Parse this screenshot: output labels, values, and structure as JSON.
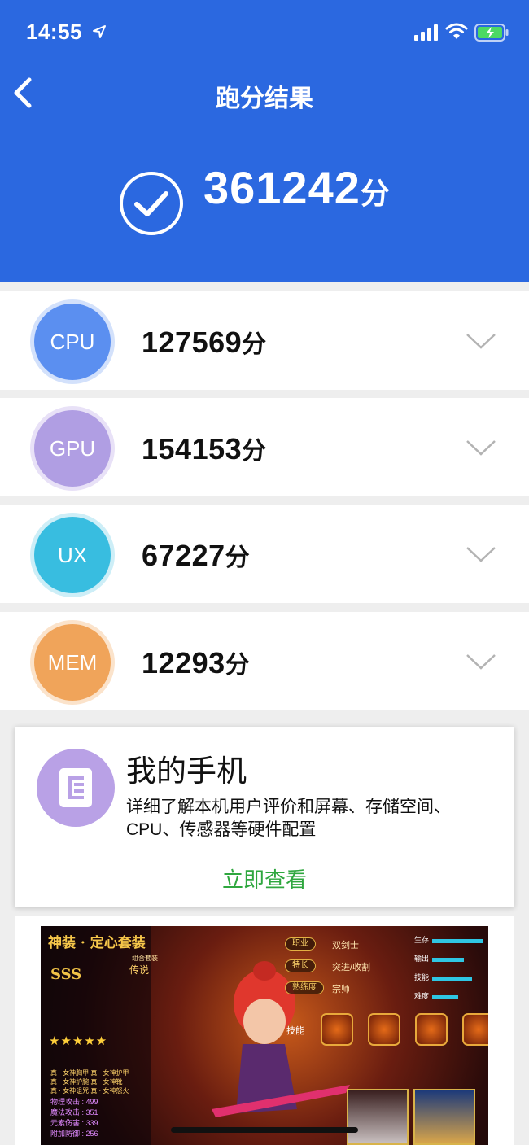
{
  "status_bar": {
    "time": "14:55",
    "icons": [
      "location-arrow-icon",
      "signal-icon",
      "wifi-icon",
      "battery-charging-icon"
    ]
  },
  "header": {
    "title": "跑分结果",
    "total_score": "361242",
    "score_unit": "分",
    "background": "#2b68e0"
  },
  "scores": [
    {
      "badge": "CPU",
      "score": "127569",
      "unit": "分",
      "color": "#5b8ff0",
      "ring": "#d3e1fb"
    },
    {
      "badge": "GPU",
      "score": "154153",
      "unit": "分",
      "color": "#b09ee3",
      "ring": "#e8e1f7"
    },
    {
      "badge": "UX",
      "score": "67227",
      "unit": "分",
      "color": "#38bde0",
      "ring": "#cdeef7"
    },
    {
      "badge": "MEM",
      "score": "12293",
      "unit": "分",
      "color": "#f0a45a",
      "ring": "#fbe3cb"
    }
  ],
  "phone_card": {
    "title": "我的手机",
    "description": "详细了解本机用户评价和屏幕、存储空间、CPU、传感器等硬件配置",
    "link": "立即查看",
    "link_color": "#2fa73f"
  },
  "ad": {
    "title": "神装 · 定心套装",
    "subtitle": "组合套装",
    "rank": "SSS",
    "legend": "传说",
    "stars": "★★★★★",
    "small_lines": [
      "真 · 女神胸甲  真 · 女神护甲",
      "真 · 女神护腕  真 · 女神靴",
      "真 · 女神诅咒  真 · 女神怒火"
    ],
    "stats": [
      "物理攻击 : 499",
      "魔法攻击 : 351",
      "元素伤害 : 339",
      "附加防御 : 256"
    ],
    "tags": [
      {
        "label": "职业",
        "value": "双剑士"
      },
      {
        "label": "特长",
        "value": "突进/收割"
      },
      {
        "label": "熟练度",
        "value": "宗师"
      }
    ],
    "attributes": [
      {
        "label": "生存",
        "level": 0.9
      },
      {
        "label": "输出",
        "level": 0.55
      },
      {
        "label": "技能",
        "level": 0.7
      },
      {
        "label": "难度",
        "level": 0.45
      }
    ],
    "skill_label": "技能"
  }
}
